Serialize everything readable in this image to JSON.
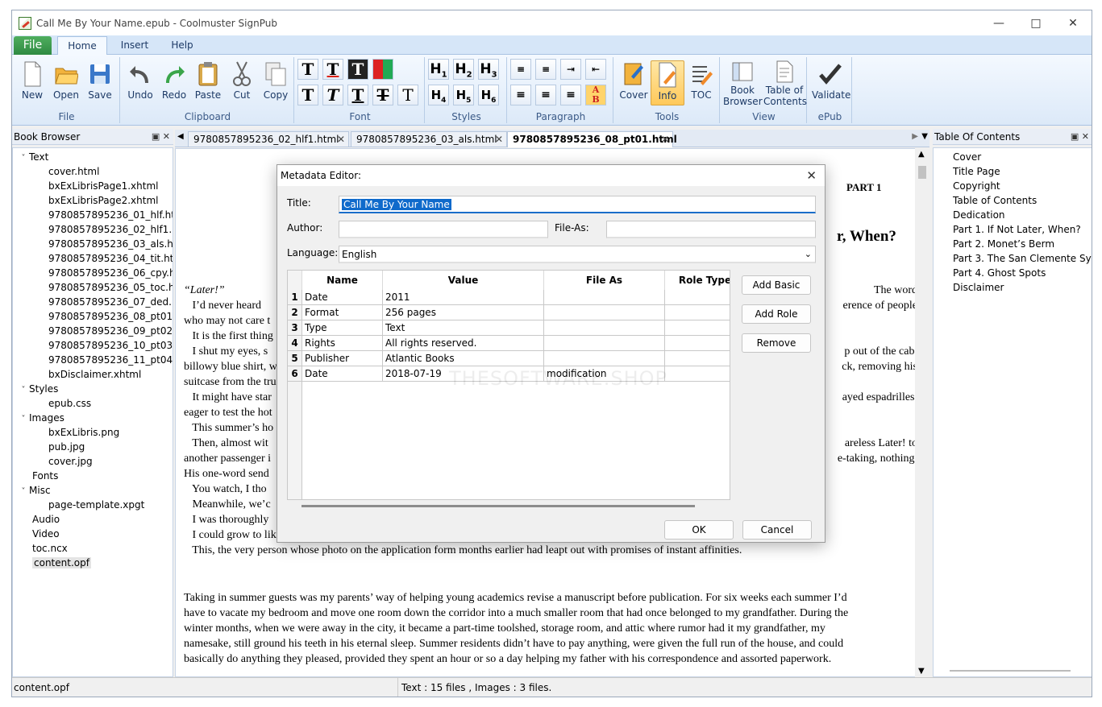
{
  "window": {
    "title": "Call Me By Your Name.epub - Coolmuster SignPub"
  },
  "ribbon_tabs": {
    "file": "File",
    "home": "Home",
    "insert": "Insert",
    "help": "Help"
  },
  "ribbon": {
    "file_group": {
      "label": "File",
      "new": "New",
      "open": "Open",
      "save": "Save"
    },
    "clipboard_group": {
      "label": "Clipboard",
      "undo": "Undo",
      "redo": "Redo",
      "paste": "Paste",
      "cut": "Cut",
      "copy": "Copy"
    },
    "font_group": {
      "label": "Font"
    },
    "styles_group": {
      "label": "Styles"
    },
    "paragraph_group": {
      "label": "Paragraph"
    },
    "tools_group": {
      "label": "Tools",
      "cover": "Cover",
      "info": "Info",
      "toc": "TOC"
    },
    "view_group": {
      "label": "View",
      "book_browser_1": "Book",
      "book_browser_2": "Browser",
      "toc_1": "Table of",
      "toc_2": "Contents"
    },
    "epub_group": {
      "label": "ePub",
      "validate": "Validate"
    }
  },
  "book_browser": {
    "title": "Book Browser",
    "text_folder": "Text",
    "text_files": [
      "cover.html",
      "bxExLibrisPage1.xhtml",
      "bxExLibrisPage2.xhtml",
      "9780857895236_01_hlf.html",
      "9780857895236_02_hlf1.html",
      "9780857895236_03_als.html",
      "9780857895236_04_tit.html",
      "9780857895236_06_cpy.html",
      "9780857895236_05_toc.html",
      "9780857895236_07_ded.html",
      "9780857895236_08_pt01.html",
      "9780857895236_09_pt02.html",
      "9780857895236_10_pt03.html",
      "9780857895236_11_pt04.html",
      "bxDisclaimer.xhtml"
    ],
    "styles_folder": "Styles",
    "style_files": [
      "epub.css"
    ],
    "images_folder": "Images",
    "image_files": [
      "bxExLibris.png",
      "pub.jpg",
      "cover.jpg"
    ],
    "fonts_folder": "Fonts",
    "misc_folder": "Misc",
    "misc_files": [
      "page-template.xpgt"
    ],
    "audio_folder": "Audio",
    "video_folder": "Video",
    "ncx": "toc.ncx",
    "opf": "content.opf"
  },
  "doc_tabs": [
    "9780857895236_02_hlf1.html",
    "9780857895236_03_als.html",
    "9780857895236_08_pt01.html"
  ],
  "editor": {
    "part": "PART   1",
    "heading_partial": "r, When?",
    "lines": [
      {
        "l": "“Later!”",
        "r": " The word"
      },
      {
        "l": "   I’d never heard",
        "r": "erence of people"
      },
      {
        "l": "who may not care t",
        "r": ""
      },
      {
        "l": "   It is the first thing",
        "r": ""
      },
      {
        "l": "   I shut my eyes, s",
        "r": "p out of the cab,"
      },
      {
        "l": "billowy blue shirt, w",
        "r": "ck, removing his"
      },
      {
        "l": "suitcase from the tru",
        "r": ""
      },
      {
        "l": "   It might have star",
        "r": "ayed espadrilles,"
      },
      {
        "l": "eager to test the hot",
        "r": ""
      },
      {
        "l": "   This summer’s ho",
        "r": ""
      },
      {
        "l": "   Then, almost wit",
        "r": "areless Later! to"
      },
      {
        "l": "another passenger i",
        "r": "e-taking, nothing."
      },
      {
        "l": "His one-word send",
        "r": ""
      },
      {
        "l": "   You watch, I tho",
        "r": ""
      },
      {
        "l": "   Meanwhile, we’c",
        "r": ""
      },
      {
        "l": "   I was thoroughly",
        "r": ""
      }
    ],
    "full_lines": [
      "   I could grow to like him, though. From rounded chin to rounded heel. Then, within days, I would learn to hate him.",
      "   This, the very person whose photo on the application form months earlier had leapt out with promises of instant affinities."
    ],
    "para2": [
      "Taking in summer guests was my parents’ way of helping young academics revise a manuscript before publication. For six weeks each summer I’d",
      "have to vacate my bedroom and move one room down the corridor into a much smaller room that had once belonged to my grandfather. During the",
      "winter months, when we were away in the city, it became a part-time toolshed, storage room, and attic where rumor had it my grandfather, my",
      "namesake, still ground his teeth in his eternal sleep. Summer residents didn’t have to pay anything, were given the full run of the house, and could",
      "basically do anything they pleased, provided they spent an hour or so a day helping my father with his correspondence and assorted paperwork."
    ]
  },
  "toc_panel": {
    "title": "Table Of Contents",
    "items": [
      "Cover",
      "Title Page",
      "Copyright",
      "Table of Contents",
      "Dedication",
      "Part 1. If Not Later, When?",
      "Part 2. Monet’s Berm",
      "Part 3. The San Clemente Syndro",
      "Part 4. Ghost Spots",
      "Disclaimer"
    ]
  },
  "status": {
    "left": "content.opf",
    "center": "Text : 15 files , Images : 3 files."
  },
  "dialog": {
    "title": "Metadata Editor:",
    "title_label": "Title:",
    "title_value": "Call Me By Your Name",
    "author_label": "Author:",
    "author_value": "",
    "fileas_label": "File-As:",
    "fileas_value": "",
    "language_label": "Language:",
    "language_value": "English",
    "columns": [
      "Name",
      "Value",
      "File As",
      "Role Type"
    ],
    "rows": [
      {
        "n": "1",
        "name": "Date",
        "value": "2011",
        "fileas": ""
      },
      {
        "n": "2",
        "name": "Format",
        "value": "256 pages",
        "fileas": ""
      },
      {
        "n": "3",
        "name": "Type",
        "value": "Text",
        "fileas": ""
      },
      {
        "n": "4",
        "name": "Rights",
        "value": "All rights reserved.",
        "fileas": ""
      },
      {
        "n": "5",
        "name": "Publisher",
        "value": "Atlantic Books",
        "fileas": ""
      },
      {
        "n": "6",
        "name": "Date",
        "value": "2018-07-19",
        "fileas": "modification"
      }
    ],
    "add_basic": "Add Basic",
    "add_role": "Add Role",
    "remove": "Remove",
    "ok": "OK",
    "cancel": "Cancel",
    "watermark": "THESOFTWARE.SHOP"
  }
}
